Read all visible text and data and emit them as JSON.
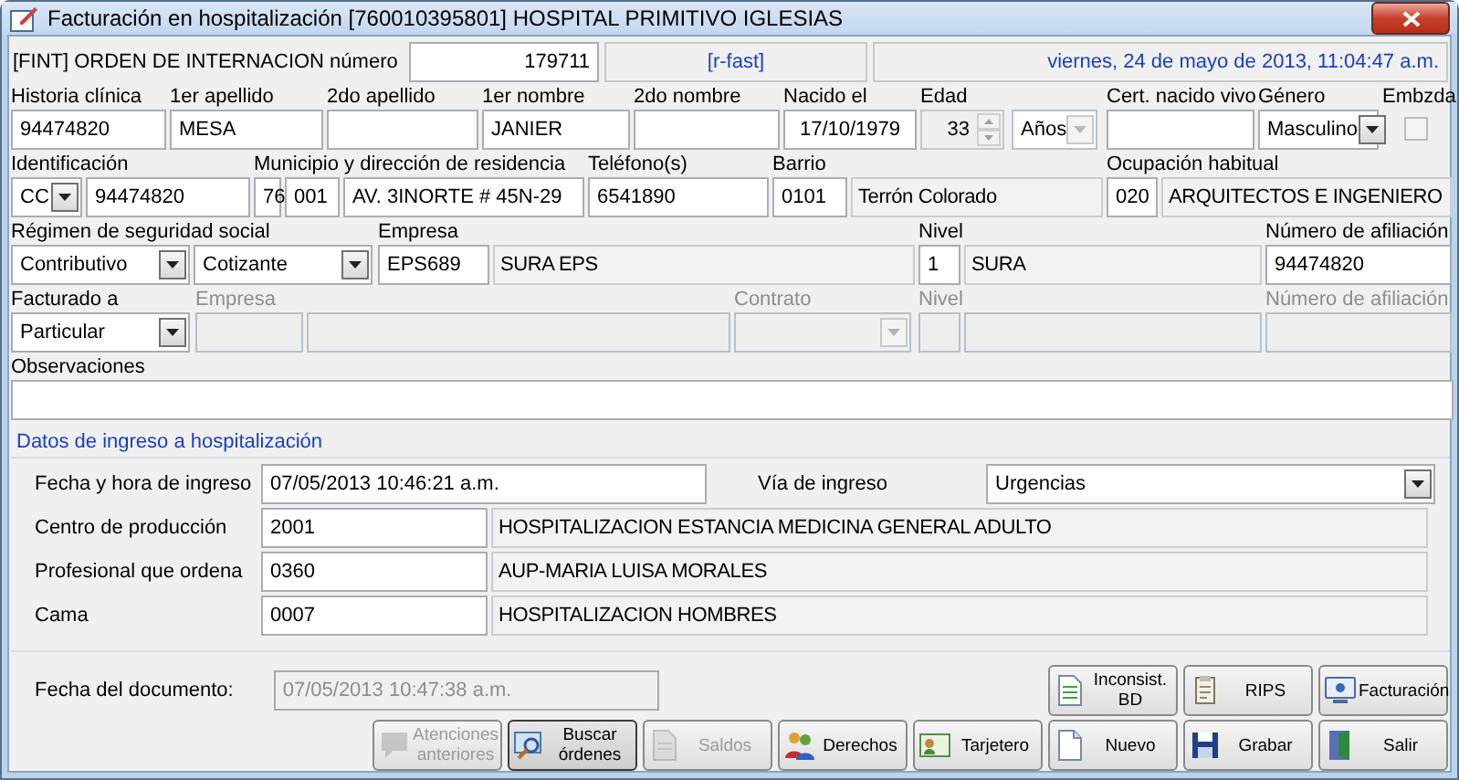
{
  "window": {
    "title": "Facturación en hospitalización [760010395801] HOSPITAL PRIMITIVO IGLESIAS"
  },
  "header": {
    "label": "[FINT] ORDEN DE INTERNACION número",
    "number": "179711",
    "mode": "[r-fast]",
    "datetime": "viernes, 24 de mayo de 2013, 11:04:47 a.m."
  },
  "patient_rows": [
    {
      "groups": [
        {
          "label": "Historia clínica",
          "disabled": false,
          "inputs": [
            {
              "kind": "text",
              "value": "94474820",
              "disabled": false
            }
          ]
        },
        {
          "label": "1er apellido",
          "disabled": false,
          "inputs": [
            {
              "kind": "text",
              "value": "MESA",
              "disabled": false
            }
          ]
        },
        {
          "label": "2do apellido",
          "disabled": false,
          "inputs": [
            {
              "kind": "text",
              "disabled": false
            }
          ]
        },
        {
          "label": "1er nombre",
          "disabled": false,
          "inputs": [
            {
              "kind": "text",
              "value": "JANIER",
              "disabled": false
            }
          ]
        },
        {
          "label": "2do nombre",
          "disabled": false,
          "inputs": [
            {
              "kind": "text",
              "disabled": false
            }
          ]
        },
        {
          "label": "Nacido el",
          "disabled": false,
          "inputs": [
            {
              "kind": "date",
              "value": "17/10/1979",
              "disabled": false
            }
          ]
        },
        {
          "label": "Edad",
          "disabled": false,
          "inputs": [
            {
              "kind": "spin",
              "value": "33",
              "disabled": true
            },
            {
              "kind": "select",
              "value": "Años",
              "disabled": true
            }
          ]
        },
        {
          "label": "Cert. nacido vivo",
          "disabled": false,
          "inputs": [
            {
              "kind": "text",
              "disabled": false
            }
          ]
        },
        {
          "label": "Género",
          "disabled": false,
          "inputs": [
            {
              "kind": "select",
              "value": "Masculino",
              "disabled": false
            }
          ]
        },
        {
          "label": "Embzda",
          "disabled": false,
          "inputs": [
            {
              "kind": "checkbox",
              "checked": false,
              "disabled": true
            }
          ]
        }
      ]
    },
    {
      "groups": [
        {
          "label": "Identificación",
          "disabled": false,
          "inputs": [
            {
              "kind": "select",
              "value": "CC",
              "disabled": false
            },
            {
              "kind": "text",
              "value": "94474820",
              "disabled": false
            }
          ]
        },
        {
          "label": "Municipio y dirección de residencia",
          "disabled": false,
          "inputs": [
            {
              "kind": "text",
              "value": "76",
              "disabled": false
            },
            {
              "kind": "text",
              "value": "001",
              "disabled": false
            },
            {
              "kind": "text",
              "value": "AV. 3INORTE # 45N-29",
              "disabled": false
            }
          ]
        },
        {
          "label": "Teléfono(s)",
          "disabled": false,
          "inputs": [
            {
              "kind": "text",
              "value": "6541890",
              "disabled": false
            }
          ]
        },
        {
          "label": "Barrio",
          "disabled": false,
          "inputs": [
            {
              "kind": "text",
              "value": "0101",
              "disabled": false
            },
            {
              "kind": "display",
              "value": "Terrón Colorado",
              "disabled": false
            }
          ]
        },
        {
          "label": "Ocupación habitual",
          "disabled": false,
          "inputs": [
            {
              "kind": "text",
              "value": "020",
              "disabled": false
            },
            {
              "kind": "display",
              "value": "ARQUITECTOS E INGENIERO",
              "disabled": false
            }
          ]
        }
      ]
    },
    {
      "groups": [
        {
          "label": "Régimen de seguridad social",
          "disabled": false,
          "inputs": [
            {
              "kind": "select",
              "value": "Contributivo",
              "disabled": false
            },
            {
              "kind": "select",
              "value": "Cotizante",
              "disabled": false
            }
          ]
        },
        {
          "label": "Empresa",
          "disabled": false,
          "inputs": [
            {
              "kind": "text",
              "value": "EPS689",
              "disabled": false
            },
            {
              "kind": "display",
              "value": "SURA EPS",
              "disabled": false
            }
          ]
        },
        {
          "label": "Nivel",
          "disabled": false,
          "inputs": [
            {
              "kind": "text",
              "value": "1",
              "disabled": false
            },
            {
              "kind": "display",
              "value": "SURA",
              "disabled": false
            }
          ]
        },
        {
          "label": "Número de afiliación",
          "disabled": false,
          "inputs": [
            {
              "kind": "text",
              "value": "94474820",
              "disabled": false
            }
          ]
        }
      ]
    },
    {
      "groups": [
        {
          "label": "Facturado a",
          "disabled": false,
          "inputs": [
            {
              "kind": "select",
              "value": "Particular",
              "disabled": false
            }
          ]
        },
        {
          "label": "Empresa",
          "disabled": true,
          "inputs": [
            {
              "kind": "text",
              "disabled": true
            },
            {
              "kind": "display",
              "disabled": true
            }
          ]
        },
        {
          "label": "Contrato",
          "disabled": true,
          "inputs": [
            {
              "kind": "select",
              "disabled": true
            }
          ]
        },
        {
          "label": "Nivel",
          "disabled": true,
          "inputs": [
            {
              "kind": "text",
              "disabled": true
            },
            {
              "kind": "display",
              "disabled": true
            }
          ]
        },
        {
          "label": "Número de afiliación",
          "disabled": true,
          "inputs": [
            {
              "kind": "text",
              "disabled": true
            }
          ]
        }
      ]
    },
    {
      "groups": [
        {
          "label": "Observaciones",
          "disabled": false,
          "inputs": [
            {
              "kind": "text",
              "disabled": false
            }
          ]
        }
      ]
    }
  ],
  "admission": {
    "title": "Datos de ingreso a hospitalización",
    "rows": [
      {
        "cells": [
          {
            "kind": "label",
            "text": "Fecha y hora de ingreso"
          },
          {
            "kind": "text",
            "value": "07/05/2013 10:46:21 a.m."
          },
          {
            "kind": "label",
            "text": "Vía de ingreso"
          },
          {
            "kind": "select",
            "value": "Urgencias"
          }
        ]
      },
      {
        "cells": [
          {
            "kind": "label",
            "text": "Centro de producción"
          },
          {
            "kind": "text",
            "value": "2001"
          },
          {
            "kind": "display",
            "value": "HOSPITALIZACION ESTANCIA MEDICINA GENERAL ADULTO"
          }
        ]
      },
      {
        "cells": [
          {
            "kind": "label",
            "text": "Profesional que ordena"
          },
          {
            "kind": "text",
            "value": "0360"
          },
          {
            "kind": "display",
            "value": "AUP-MARIA LUISA MORALES"
          }
        ]
      },
      {
        "cells": [
          {
            "kind": "label",
            "text": "Cama"
          },
          {
            "kind": "text",
            "value": "0007"
          },
          {
            "kind": "display",
            "value": "HOSPITALIZACION HOMBRES"
          }
        ]
      }
    ]
  },
  "document_date": {
    "label": "Fecha del documento:",
    "value": "07/05/2013 10:47:38 a.m.",
    "disabled": true
  },
  "top_buttons": [
    {
      "label": "Inconsist.\nBD",
      "disabled": false,
      "focused": false
    },
    {
      "label": "RIPS",
      "disabled": false,
      "focused": false
    },
    {
      "label": "Facturación",
      "disabled": false,
      "focused": false
    }
  ],
  "bottom_buttons": [
    {
      "label": "Atenciones\nanteriores",
      "disabled": true,
      "focused": false
    },
    {
      "label": "Buscar\nórdenes",
      "disabled": false,
      "focused": true
    },
    {
      "label": "Saldos",
      "disabled": true,
      "focused": false
    },
    {
      "label": "Derechos",
      "disabled": false,
      "focused": false
    },
    {
      "label": "Tarjetero",
      "disabled": false,
      "focused": false
    },
    {
      "label": "Nuevo",
      "disabled": false,
      "focused": false
    },
    {
      "label": "Grabar",
      "disabled": false,
      "focused": false
    },
    {
      "label": "Salir",
      "disabled": false,
      "focused": false
    }
  ]
}
